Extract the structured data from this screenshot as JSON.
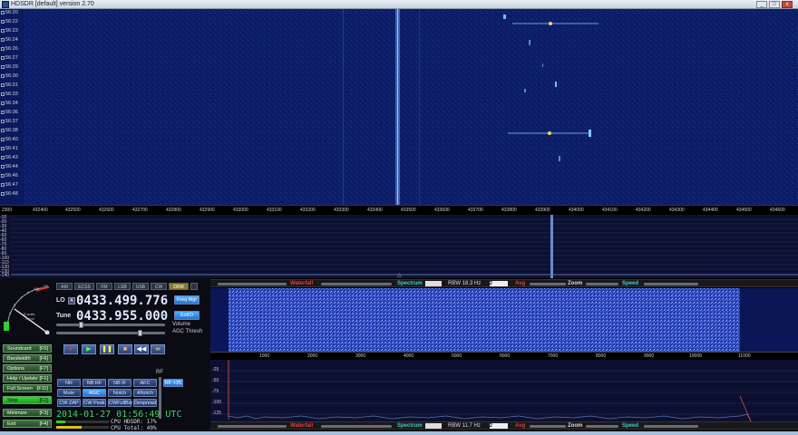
{
  "window": {
    "title": "HDSDR [default]  version 2.70",
    "controls": [
      "_",
      "□",
      "x"
    ]
  },
  "waterfall": {
    "timestamps": [
      "56:20",
      "56:22",
      "56:23",
      "56:24",
      "56:26",
      "56:27",
      "56:29",
      "56:30",
      "56:31",
      "56:33",
      "56:34",
      "56:36",
      "56:37",
      "56:38",
      "56:40",
      "56:41",
      "56:43",
      "56:44",
      "56:46",
      "56:47",
      "56:48"
    ]
  },
  "freq_scale": {
    "start_label": "2300",
    "ticks": [
      "432400",
      "432500",
      "432600",
      "432700",
      "432800",
      "432900",
      "433000",
      "433100",
      "433200",
      "433300",
      "433400",
      "433500",
      "433600",
      "433700",
      "433800",
      "433900",
      "434000",
      "434100",
      "434200",
      "434300",
      "434400",
      "434500",
      "434600"
    ]
  },
  "spectrum": {
    "db_labels": [
      "-10",
      "-20",
      "-30",
      "-40",
      "-50",
      "-60",
      "-70",
      "-80",
      "-90",
      "-100",
      "-110",
      "-120",
      "-130",
      "-140"
    ]
  },
  "modes": [
    "AM",
    "ECSS",
    "FM",
    "LSB",
    "USB",
    "CW",
    "DRM"
  ],
  "meter": {
    "label": "S-units",
    "scale": [
      "1",
      "3",
      "5",
      "7",
      "9",
      "+20",
      "+40"
    ],
    "sub": "Signal"
  },
  "lo": {
    "label": "LO",
    "badge": "A",
    "value": "0433.499.776",
    "btn": "Freq Mgr"
  },
  "tune": {
    "label": "Tune",
    "value": "0433.955.000",
    "btn": "ExtIO"
  },
  "volume_label": "Volume",
  "agc_label": "AGC Thresh",
  "left_buttons": [
    {
      "name": "Soundcard",
      "key": "[F5]"
    },
    {
      "name": "Bandwidth",
      "key": "[F6]"
    },
    {
      "name": "Options",
      "key": "[F7]"
    },
    {
      "name": "Help / Update",
      "key": "[F1]"
    },
    {
      "name": "Full Screen",
      "key": "[F11]"
    },
    {
      "name": "Stop",
      "key": "[F2]"
    },
    {
      "name": "Minimize",
      "key": "[F3]"
    },
    {
      "name": "Exit",
      "key": "[F4]"
    }
  ],
  "dsp_row1": [
    "NR",
    "NB RF",
    "NB IF",
    "AFC"
  ],
  "dsp_row2": [
    "Mute",
    "AGC Slow",
    "Notch",
    "ANotch"
  ],
  "dsp_row3": [
    "CW ZAP",
    "CW Peak",
    "CWFullBw",
    "Despread"
  ],
  "rf_label": "RF",
  "rf_btn": "RF +25",
  "datetime": "2014-01-27  01:56:49 UTC",
  "cpu": {
    "hdsdr": "CPU HDSDR: 17%",
    "total": "CPU Total: 49%"
  },
  "top_bar": {
    "waterfall": "Waterfall",
    "spectrum": "Spectrum",
    "rbw": "RBW 18.3 Hz",
    "rbw_sel": "2",
    "avg": "Avg",
    "zoom": "Zoom",
    "speed": "Speed"
  },
  "bottom_bar": {
    "waterfall": "Waterfall",
    "spectrum": "Spectrum",
    "rbw": "RBW 11.7 Hz",
    "rbw_sel": "2",
    "avg": "Avg",
    "zoom": "Zoom",
    "speed": "Speed"
  },
  "audio_scale": [
    "1000",
    "2000",
    "3000",
    "4000",
    "5000",
    "6000",
    "7000",
    "8000",
    "9000",
    "10000",
    "11000"
  ],
  "audio_db": [
    "-25",
    "-50",
    "-75",
    "-100",
    "-125"
  ],
  "colors": {
    "waterfall_bg": "#0a1a5c",
    "trace": "#5a74b0",
    "accent": "#3fa0ff",
    "stop": "#22cc22"
  }
}
